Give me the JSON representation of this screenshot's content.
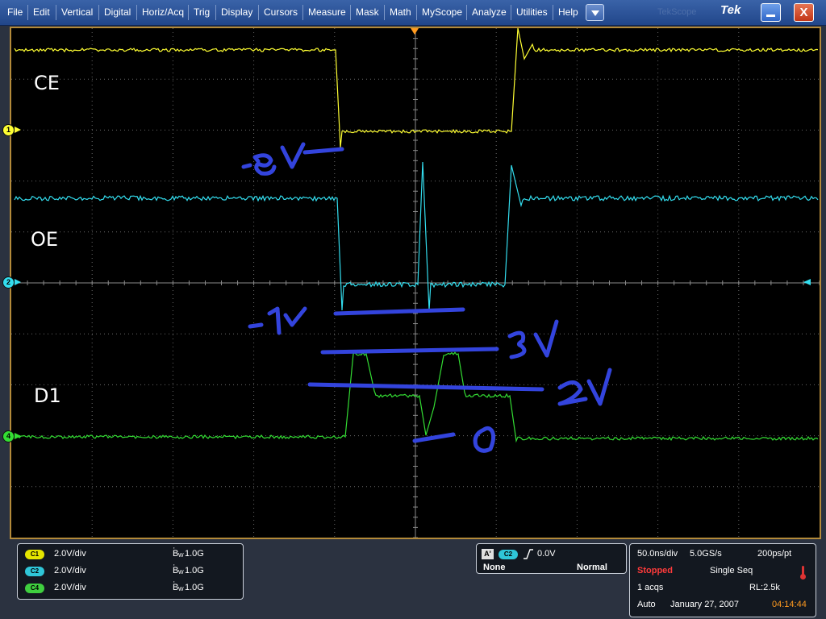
{
  "menu": {
    "items": [
      "File",
      "Edit",
      "Vertical",
      "Digital",
      "Horiz/Acq",
      "Trig",
      "Display",
      "Cursors",
      "Measure",
      "Mask",
      "Math",
      "MyScope",
      "Analyze",
      "Utilities",
      "Help"
    ],
    "brand": "Tek",
    "faded_text": "TekScope",
    "close_label": "X"
  },
  "display": {
    "channel_labels": [
      "CE",
      "OE",
      "D1"
    ],
    "channel_colors": {
      "ch1": "#ffff33",
      "ch2": "#33ddee",
      "ch4": "#33dd33"
    },
    "annotation_color": "#3344dd",
    "grid_color": "#6a6a6a",
    "markers": {
      "ch1": "1",
      "ch2": "2",
      "ch4": "4"
    }
  },
  "channels_panel": {
    "rows": [
      {
        "badge": "C1",
        "scale": "2.0V/div",
        "bw": "1.0G",
        "color": "#e6e600"
      },
      {
        "badge": "C2",
        "scale": "2.0V/div",
        "bw": "1.0G",
        "color": "#2fc6d8"
      },
      {
        "badge": "C4",
        "scale": "2.0V/div",
        "bw": "1.0G",
        "color": "#3fcf3f"
      }
    ],
    "bw_prefix": "B",
    "bw_sub": "W",
    "bw_sup": "'"
  },
  "trigger_panel": {
    "ref": "A'",
    "source": "C2",
    "level": "0.0V",
    "coupling": "None",
    "mode": "Normal"
  },
  "timebase_panel": {
    "scale": "50.0ns/div",
    "sample_rate": "5.0GS/s",
    "resolution": "200ps/pt",
    "state": "Stopped",
    "acq_mode": "Single Seq",
    "acqs": "1 acqs",
    "record_length": "RL:2.5k",
    "trigger_mode": "Auto",
    "date": "January 27, 2007",
    "time": "04:14:44"
  }
}
